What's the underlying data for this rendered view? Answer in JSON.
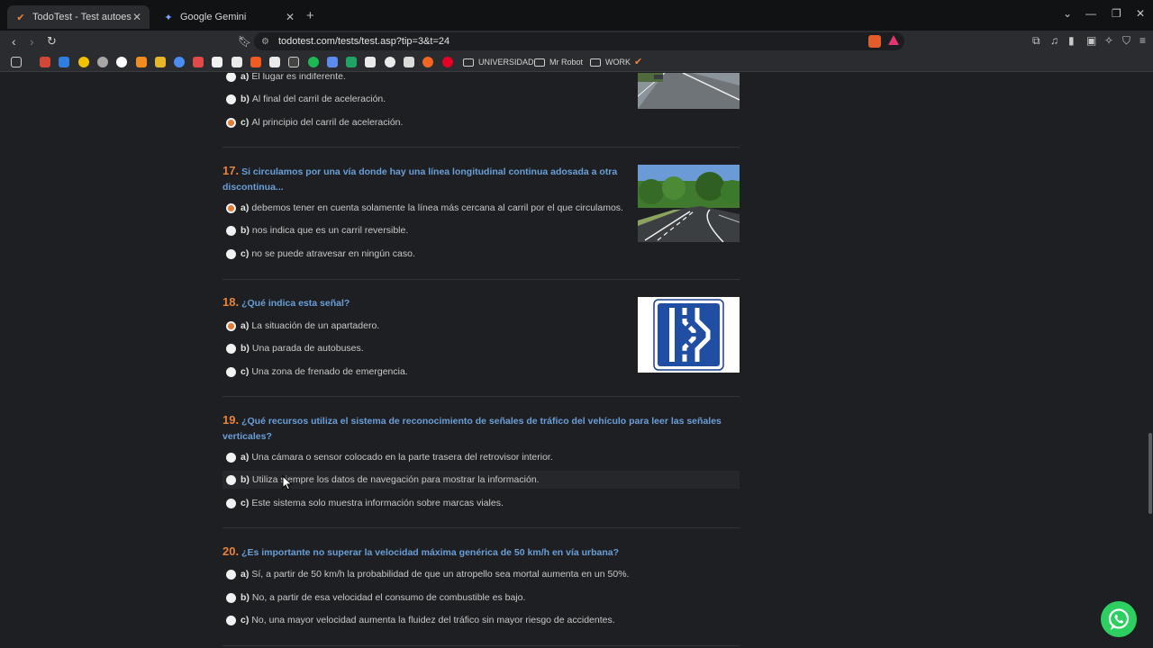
{
  "browser": {
    "tabs": [
      {
        "title": "TodoTest - Test autoescuela grat",
        "active": true
      },
      {
        "title": "Google Gemini",
        "active": false
      }
    ],
    "url": "todotest.com/tests/test.asp?tip=3&t=24",
    "bookmark_folders": [
      "UNIVERSIDAD",
      "Mr Robot",
      "WORK"
    ]
  },
  "colors": {
    "question_text": "#6a9fd8",
    "question_number": "#e8833a",
    "selected_radio": "#e07b39",
    "background": "#1e1f22"
  },
  "partial_question": {
    "options": [
      {
        "letter": "a)",
        "text": "El lugar es indiferente.",
        "selected": false
      },
      {
        "letter": "b)",
        "text": "Al final del carril de aceleración.",
        "selected": false
      },
      {
        "letter": "c)",
        "text": "Al principio del carril de aceleración.",
        "selected": true
      }
    ]
  },
  "questions": [
    {
      "number": "17.",
      "text": "Si circulamos por una vía donde hay una línea longitudinal continua adosada a otra discontinua...",
      "image": "road-photo",
      "options": [
        {
          "letter": "a)",
          "text": "debemos tener en cuenta solamente la línea más cercana al carril por el que circulamos.",
          "selected": true
        },
        {
          "letter": "b)",
          "text": "nos indica que es un carril reversible.",
          "selected": false
        },
        {
          "letter": "c)",
          "text": "no se puede atravesar en ningún caso.",
          "selected": false
        }
      ]
    },
    {
      "number": "18.",
      "text": "¿Qué indica esta señal?",
      "image": "traffic-sign",
      "options": [
        {
          "letter": "a)",
          "text": "La situación de un apartadero.",
          "selected": true
        },
        {
          "letter": "b)",
          "text": "Una parada de autobuses.",
          "selected": false
        },
        {
          "letter": "c)",
          "text": "Una zona de frenado de emergencia.",
          "selected": false
        }
      ]
    },
    {
      "number": "19.",
      "text": "¿Qué recursos utiliza el sistema de reconocimiento de señales de tráfico del vehículo para leer las señales verticales?",
      "options": [
        {
          "letter": "a)",
          "text": "Una cámara o sensor colocado en la parte trasera del retrovisor interior.",
          "selected": false
        },
        {
          "letter": "b)",
          "text": "Utiliza siempre los datos de navegación para mostrar la información.",
          "selected": false
        },
        {
          "letter": "c)",
          "text": "Este sistema solo muestra información sobre marcas viales.",
          "selected": false
        }
      ]
    },
    {
      "number": "20.",
      "text": "¿Es importante no superar la velocidad máxima genérica de 50 km/h en vía urbana?",
      "options": [
        {
          "letter": "a)",
          "text": "Sí, a partir de 50 km/h la probabilidad de que un atropello sea mortal aumenta en un 50%.",
          "selected": false
        },
        {
          "letter": "b)",
          "text": "No, a partir de esa velocidad el consumo de combustible es bajo.",
          "selected": false
        },
        {
          "letter": "c)",
          "text": "No, una mayor velocidad aumenta la fluidez del tráfico sin mayor riesgo de accidentes.",
          "selected": false
        }
      ]
    }
  ]
}
